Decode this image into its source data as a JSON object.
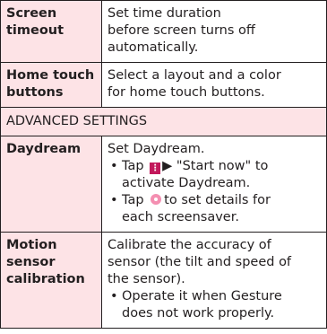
{
  "rows": [
    {
      "name_lines": [
        "Screen",
        "timeout"
      ],
      "desc_lines": [
        "Set time duration",
        "before screen turns off",
        "automatically."
      ]
    },
    {
      "name_lines": [
        "Home touch",
        "buttons"
      ],
      "desc_lines": [
        "Select a layout and a color",
        "for home touch buttons."
      ]
    }
  ],
  "section": {
    "title": "ADVANCED SETTINGS"
  },
  "daydream": {
    "name": "Daydream",
    "intro": "Set Daydream.",
    "bullet_symbol": "•",
    "bullet1": {
      "tap": "Tap",
      "arrow": "▶",
      "rest": "\"Start now\" to",
      "line2": "activate Daydream."
    },
    "bullet2": {
      "tap": "Tap",
      "rest": "to set details for",
      "line2": "each screensaver."
    },
    "icons": {
      "menu": "menu-icon",
      "settings": "settings-icon",
      "menu_color": "#c2185b",
      "settings_color": "#f48fb1"
    }
  },
  "motion": {
    "name_lines": [
      "Motion",
      "sensor",
      "calibration"
    ],
    "desc_lines": [
      "Calibrate the accuracy of",
      "sensor (the tilt and speed of",
      "the sensor)."
    ],
    "bullet_lines": [
      "Operate it when Gesture",
      "does not work properly."
    ]
  },
  "colors": {
    "header_bg": "#fde3e6",
    "border": "#231f20",
    "text": "#231f20"
  }
}
